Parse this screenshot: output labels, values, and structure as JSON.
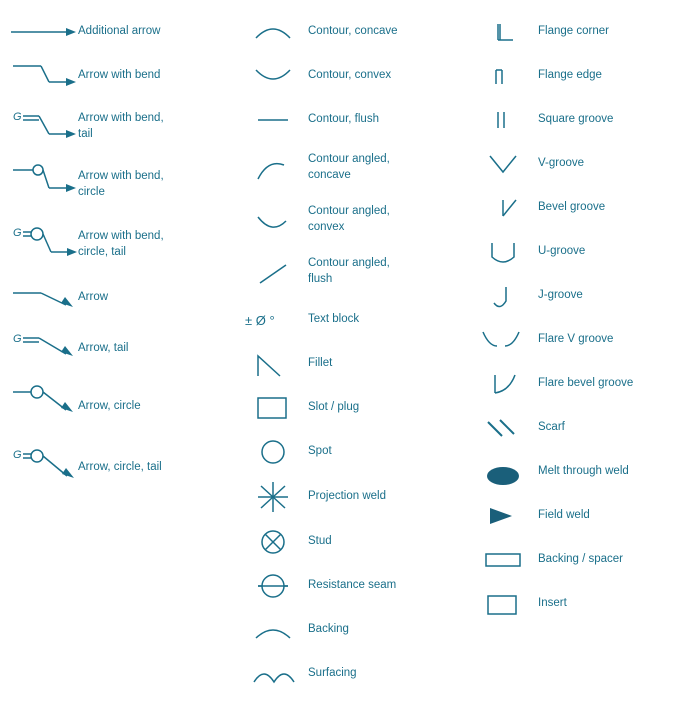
{
  "col1": {
    "items": [
      {
        "id": "additional-arrow",
        "label": "Additional arrow"
      },
      {
        "id": "arrow-with-bend",
        "label": "Arrow with bend"
      },
      {
        "id": "arrow-with-bend-tail",
        "label": "Arrow with bend,\ntail"
      },
      {
        "id": "arrow-with-bend-circle",
        "label": "Arrow with bend,\ncircle"
      },
      {
        "id": "arrow-with-bend-circle-tail",
        "label": "Arrow with bend,\ncircle, tail"
      },
      {
        "id": "arrow",
        "label": "Arrow"
      },
      {
        "id": "arrow-tail",
        "label": "Arrow, tail"
      },
      {
        "id": "arrow-circle",
        "label": "Arrow, circle"
      },
      {
        "id": "arrow-circle-tail",
        "label": "Arrow, circle, tail"
      }
    ]
  },
  "col2": {
    "items": [
      {
        "id": "contour-concave",
        "label": "Contour, concave"
      },
      {
        "id": "contour-convex",
        "label": "Contour, convex"
      },
      {
        "id": "contour-flush",
        "label": "Contour, flush"
      },
      {
        "id": "contour-angled-concave",
        "label": "Contour angled,\nconcave"
      },
      {
        "id": "contour-angled-convex",
        "label": "Contour angled,\nconvex"
      },
      {
        "id": "contour-angled-flush",
        "label": "Contour angled,\nflush"
      },
      {
        "id": "text-block",
        "label": "Text block"
      },
      {
        "id": "fillet",
        "label": "Fillet"
      },
      {
        "id": "slot-plug",
        "label": "Slot / plug"
      },
      {
        "id": "spot",
        "label": "Spot"
      },
      {
        "id": "projection-weld",
        "label": "Projection weld"
      },
      {
        "id": "stud",
        "label": "Stud"
      },
      {
        "id": "resistance-seam",
        "label": "Resistance seam"
      },
      {
        "id": "backing",
        "label": "Backing"
      },
      {
        "id": "surfacing",
        "label": "Surfacing"
      }
    ]
  },
  "col3": {
    "items": [
      {
        "id": "flange-corner",
        "label": "Flange corner"
      },
      {
        "id": "flange-edge",
        "label": "Flange edge"
      },
      {
        "id": "square-groove",
        "label": "Square groove"
      },
      {
        "id": "v-groove",
        "label": "V-groove"
      },
      {
        "id": "bevel-groove",
        "label": "Bevel groove"
      },
      {
        "id": "u-groove",
        "label": "U-groove"
      },
      {
        "id": "j-groove",
        "label": "J-groove"
      },
      {
        "id": "flare-v-groove",
        "label": "Flare V groove"
      },
      {
        "id": "flare-bevel-groove",
        "label": "Flare bevel groove"
      },
      {
        "id": "scarf",
        "label": "Scarf"
      },
      {
        "id": "melt-through-weld",
        "label": "Melt through weld"
      },
      {
        "id": "field-weld",
        "label": "Field weld"
      },
      {
        "id": "backing-spacer",
        "label": "Backing / spacer"
      },
      {
        "id": "insert",
        "label": "Insert"
      }
    ]
  }
}
